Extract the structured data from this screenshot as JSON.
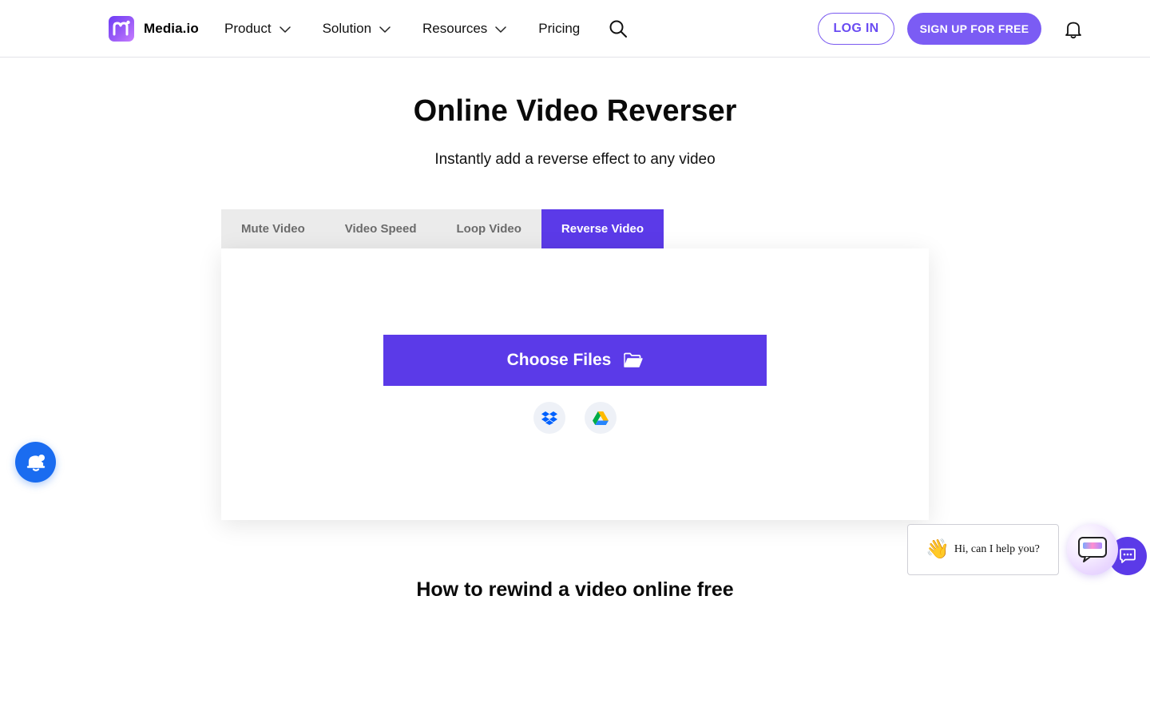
{
  "header": {
    "brand": "Media.io",
    "nav": [
      {
        "label": "Product",
        "has_dropdown": true
      },
      {
        "label": "Solution",
        "has_dropdown": true
      },
      {
        "label": "Resources",
        "has_dropdown": true
      },
      {
        "label": "Pricing",
        "has_dropdown": false
      }
    ],
    "login_label": "LOG IN",
    "signup_label": "SIGN UP FOR FREE",
    "icons": {
      "search": "search-icon",
      "notifications": "bell-icon",
      "dropdown": "chevron-down-icon"
    }
  },
  "hero": {
    "title": "Online Video Reverser",
    "subtitle": "Instantly add a reverse effect to any video"
  },
  "tabs": [
    {
      "label": "Mute Video",
      "active": false
    },
    {
      "label": "Video Speed",
      "active": false
    },
    {
      "label": "Loop Video",
      "active": false
    },
    {
      "label": "Reverse Video",
      "active": true
    }
  ],
  "upload": {
    "choose_label": "Choose Files",
    "sources": [
      "dropbox-icon",
      "google-drive-icon"
    ]
  },
  "section": {
    "heading": "How to rewind a video online free"
  },
  "chat": {
    "greeting": "Hi, can I help you?",
    "emoji": "👋"
  },
  "colors": {
    "primary": "#5b3ae8",
    "signup": "#7b5cf4",
    "notify_fab": "#1a6cf0",
    "tab_bg": "#ebebeb"
  }
}
